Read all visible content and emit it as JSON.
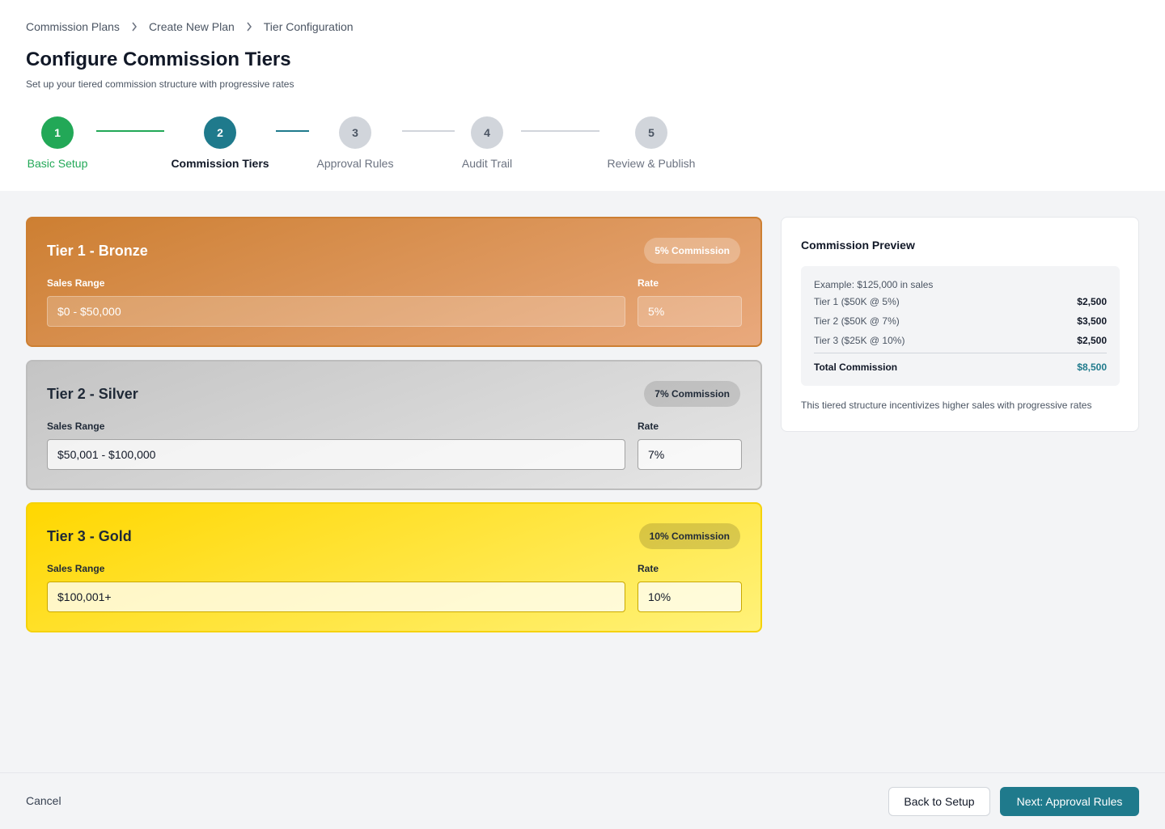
{
  "breadcrumb": {
    "items": [
      "Commission Plans",
      "Create New Plan",
      "Tier Configuration"
    ]
  },
  "header": {
    "title": "Configure Commission Tiers",
    "subtitle": "Set up your tiered commission structure with progressive rates"
  },
  "stepper": {
    "steps": [
      {
        "number": "1",
        "label": "Basic Setup",
        "state": "completed"
      },
      {
        "number": "2",
        "label": "Commission Tiers",
        "state": "active"
      },
      {
        "number": "3",
        "label": "Approval Rules",
        "state": "upcoming"
      },
      {
        "number": "4",
        "label": "Audit Trail",
        "state": "upcoming"
      },
      {
        "number": "5",
        "label": "Review & Publish",
        "state": "upcoming"
      }
    ],
    "colors": {
      "completed": "#22a857",
      "active": "#1f7a8c",
      "upcoming": "#d1d5db"
    }
  },
  "tiers": [
    {
      "title": "Tier 1 - Bronze",
      "badge": "5% Commission",
      "range_label": "Sales Range",
      "range_value": "$0 - $50,000",
      "rate_label": "Rate",
      "rate_value": "5%",
      "color": "#cd7f32"
    },
    {
      "title": "Tier 2 - Silver",
      "badge": "7% Commission",
      "range_label": "Sales Range",
      "range_value": "$50,001 - $100,000",
      "rate_label": "Rate",
      "rate_value": "7%",
      "color": "#c0c0c0"
    },
    {
      "title": "Tier 3 - Gold",
      "badge": "10% Commission",
      "range_label": "Sales Range",
      "range_value": "$100,001+",
      "rate_label": "Rate",
      "rate_value": "10%",
      "color": "#ffd700"
    }
  ],
  "preview": {
    "title": "Commission Preview",
    "example": "Example: $125,000 in sales",
    "rows": [
      {
        "label": "Tier 1 ($50K @ 5%)",
        "value": "$2,500"
      },
      {
        "label": "Tier 2 ($50K @ 7%)",
        "value": "$3,500"
      },
      {
        "label": "Tier 3 ($25K @ 10%)",
        "value": "$2,500"
      }
    ],
    "total_label": "Total Commission",
    "total_value": "$8,500",
    "note": "This tiered structure incentivizes higher sales with progressive rates"
  },
  "footer": {
    "cancel": "Cancel",
    "back": "Back to Setup",
    "next": "Next: Approval Rules"
  },
  "colors": {
    "accent": "#1f7a8c",
    "success": "#22a857"
  }
}
